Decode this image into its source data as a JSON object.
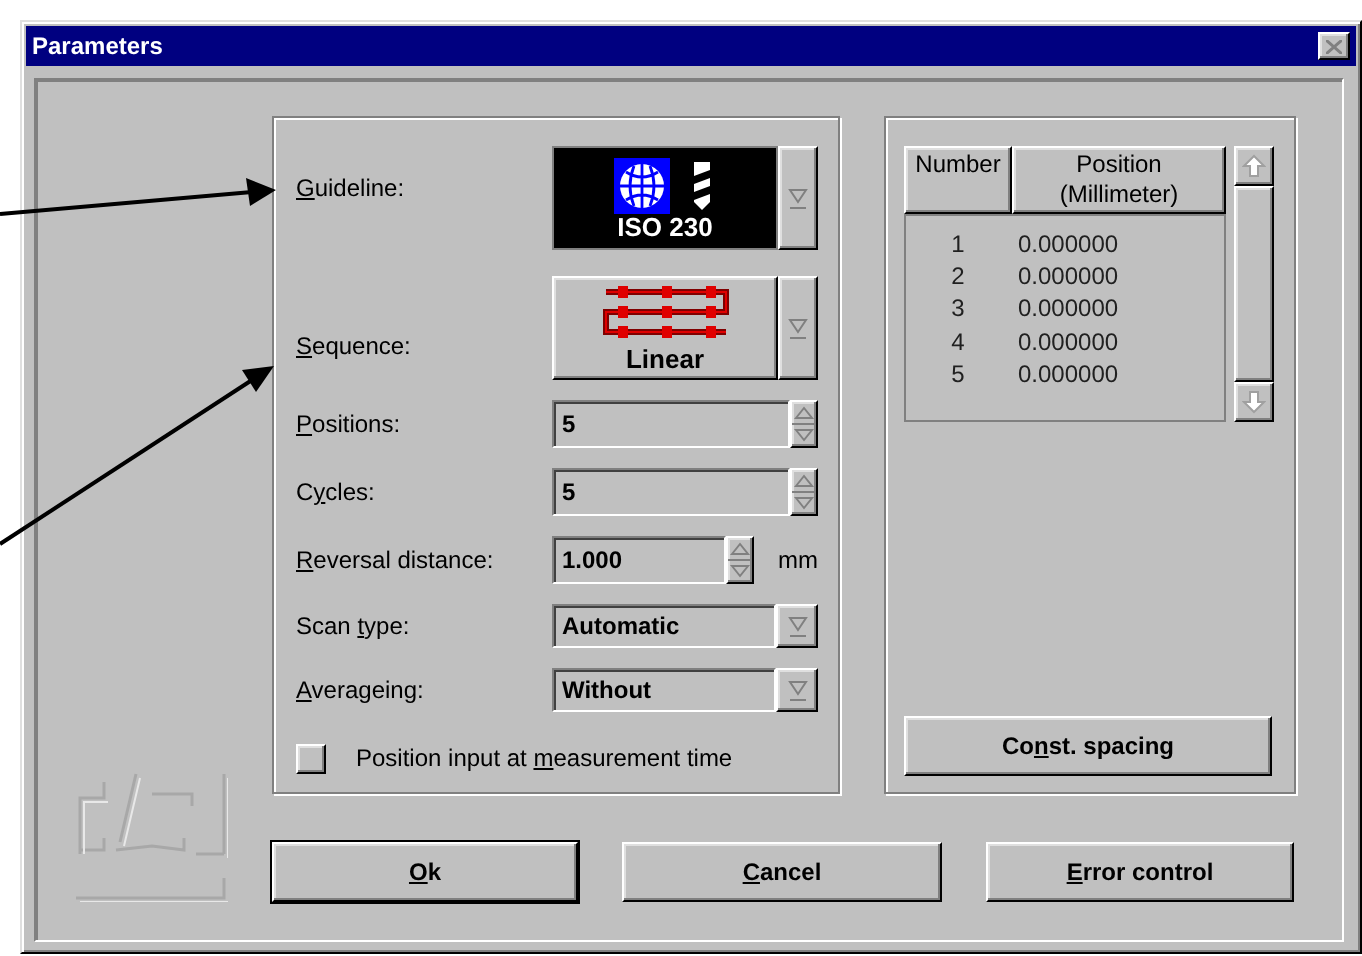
{
  "window": {
    "title": "Parameters"
  },
  "guideline": {
    "accel": "G",
    "label_post": "uideline:",
    "value": "ISO 230"
  },
  "sequence": {
    "accel": "S",
    "label_post": "equence:",
    "value": "Linear"
  },
  "fields": [
    {
      "kind": "spin",
      "accel": "P",
      "label_post": "ositions:",
      "value": "5"
    },
    {
      "kind": "spin",
      "label_pre": "C",
      "accel": "y",
      "label_post": "cles:",
      "value": "5"
    },
    {
      "kind": "spin",
      "accel": "R",
      "label_post": "eversal distance:",
      "value": "1.000",
      "unit": "mm"
    },
    {
      "kind": "combo",
      "label_pre": "Scan ",
      "accel": "t",
      "label_post": "ype:",
      "value": "Automatic"
    },
    {
      "kind": "combo",
      "accel": "A",
      "label_post": "verageing:",
      "value": "Without"
    }
  ],
  "option": {
    "label_pre": "Position input at ",
    "accel": "m",
    "label_post": "easurement time",
    "checked": false
  },
  "table": {
    "columns": [
      "Number",
      "Position (Millimeter)"
    ],
    "rows": [
      [
        "1",
        "0.000000"
      ],
      [
        "2",
        "0.000000"
      ],
      [
        "3",
        "0.000000"
      ],
      [
        "4",
        "0.000000"
      ],
      [
        "5",
        "0.000000"
      ]
    ]
  },
  "spacing_button": {
    "label_pre": "Co",
    "accel": "n",
    "label_post": "st. spacing"
  },
  "buttons": [
    {
      "accel": "O",
      "label_post": "k",
      "default": true
    },
    {
      "accel": "C",
      "label_post": "ancel",
      "default": false
    },
    {
      "accel": "E",
      "label_post": "rror control",
      "default": false
    }
  ]
}
